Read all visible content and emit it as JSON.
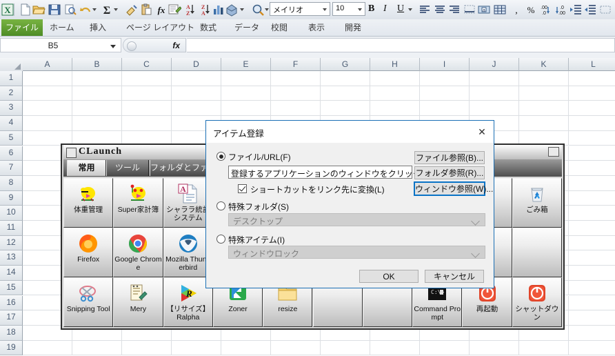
{
  "app": {
    "quick_access": {
      "icons": [
        "excel-logo-icon",
        "new-file-icon",
        "open-folder-icon",
        "save-icon",
        "print-preview-icon",
        "undo-icon",
        "autosum-icon",
        "format-painter-icon",
        "paste-icon",
        "insert-function-icon",
        "properties-icon",
        "sort-ascending-icon",
        "sort-descending-icon",
        "chart-icon",
        "shapes-icon",
        "zoom-icon"
      ],
      "font_name": "メイリオ",
      "font_size": "10",
      "bold_label": "B",
      "italic_label": "I",
      "underline_label": "U",
      "format_icons": [
        "align-left-icon",
        "align-center-icon",
        "align-right-icon",
        "wrap-text-icon",
        "merge-center-icon",
        "borders-icon",
        "comma-style-icon",
        "percent-style-icon",
        "increase-decimal-icon",
        "decrease-decimal-icon",
        "increase-indent-icon",
        "decrease-indent-icon",
        "outline-border-icon"
      ]
    },
    "ribbon_tabs": [
      {
        "label": "ファイル",
        "active": true
      },
      {
        "label": "ホーム",
        "active": false
      },
      {
        "label": "挿入",
        "active": false
      },
      {
        "label": "ページ レイアウト",
        "active": false
      },
      {
        "label": "数式",
        "active": false
      },
      {
        "label": "データ",
        "active": false
      },
      {
        "label": "校閲",
        "active": false
      },
      {
        "label": "表示",
        "active": false
      },
      {
        "label": "開発",
        "active": false
      }
    ],
    "formula_bar": {
      "name_box": "B5",
      "fx_label": "fx",
      "formula_value": ""
    },
    "sheet": {
      "columns": [
        "A",
        "B",
        "C",
        "D",
        "E",
        "F",
        "G",
        "H",
        "I",
        "J",
        "K",
        "L"
      ],
      "rows": [
        "1",
        "2",
        "3",
        "4",
        "5",
        "6",
        "7",
        "8",
        "9",
        "10",
        "11",
        "12",
        "13",
        "14",
        "15",
        "16",
        "17",
        "18",
        "19"
      ]
    }
  },
  "claunch": {
    "title": "CLaunch",
    "tabs": [
      {
        "label": "常用",
        "active": true
      },
      {
        "label": "ツール",
        "active": false
      },
      {
        "label": "フォルダとファ",
        "active": false
      }
    ],
    "items": [
      {
        "row": 0,
        "col": 0,
        "label": "体重管理",
        "icon": "chick-blue-icon"
      },
      {
        "row": 0,
        "col": 1,
        "label": "Super家計簿",
        "icon": "chick-flower-icon"
      },
      {
        "row": 0,
        "col": 2,
        "label": "シャララ統計システム",
        "icon": "access-document-icon"
      },
      {
        "row": 0,
        "col": 9,
        "label": "ごみ箱",
        "icon": "recycle-bin-icon"
      },
      {
        "row": 1,
        "col": 0,
        "label": "Firefox",
        "icon": "firefox-icon"
      },
      {
        "row": 1,
        "col": 1,
        "label": "Google Chrome",
        "icon": "chrome-icon"
      },
      {
        "row": 1,
        "col": 2,
        "label": "Mozilla Thunderbird",
        "icon": "thunderbird-icon"
      },
      {
        "row": 2,
        "col": 0,
        "label": "Snipping Tool",
        "icon": "snipping-tool-icon"
      },
      {
        "row": 2,
        "col": 1,
        "label": "Mery",
        "icon": "notepad-pencil-icon"
      },
      {
        "row": 2,
        "col": 2,
        "label": "【リサイズ】Ralpha",
        "icon": "ralpha-icon"
      },
      {
        "row": 2,
        "col": 3,
        "label": "Zoner",
        "icon": "zoner-icon"
      },
      {
        "row": 2,
        "col": 4,
        "label": "resize",
        "icon": "folder-icon"
      },
      {
        "row": 2,
        "col": 7,
        "label": "Command Prompt",
        "icon": "command-prompt-icon"
      },
      {
        "row": 2,
        "col": 8,
        "label": "再起動",
        "icon": "power-red-icon"
      },
      {
        "row": 2,
        "col": 9,
        "label": "シャットダウン",
        "icon": "power-red-icon"
      }
    ]
  },
  "dialog": {
    "title": "アイテム登録",
    "close_label": "✕",
    "file_url_radio": "ファイル/URL(F)",
    "file_url_selected": true,
    "path_value": "登録するアプリケーションのウィンドウをクリック",
    "shortcut_checkbox": "ショートカットをリンク先に変換(L)",
    "shortcut_checked": true,
    "browse_file_button": "ファイル参照(B)...",
    "browse_folder_button": "フォルダ参照(R)...",
    "browse_window_button": "ウィンドウ参照(W)...",
    "special_folder_radio": "特殊フォルダ(S)",
    "special_folder_value": "デスクトップ",
    "special_item_radio": "特殊アイテム(I)",
    "special_item_value": "ウィンドウロック",
    "ok_button": "OK",
    "cancel_button": "キャンセル",
    "focus_color": "#0a73c6"
  }
}
